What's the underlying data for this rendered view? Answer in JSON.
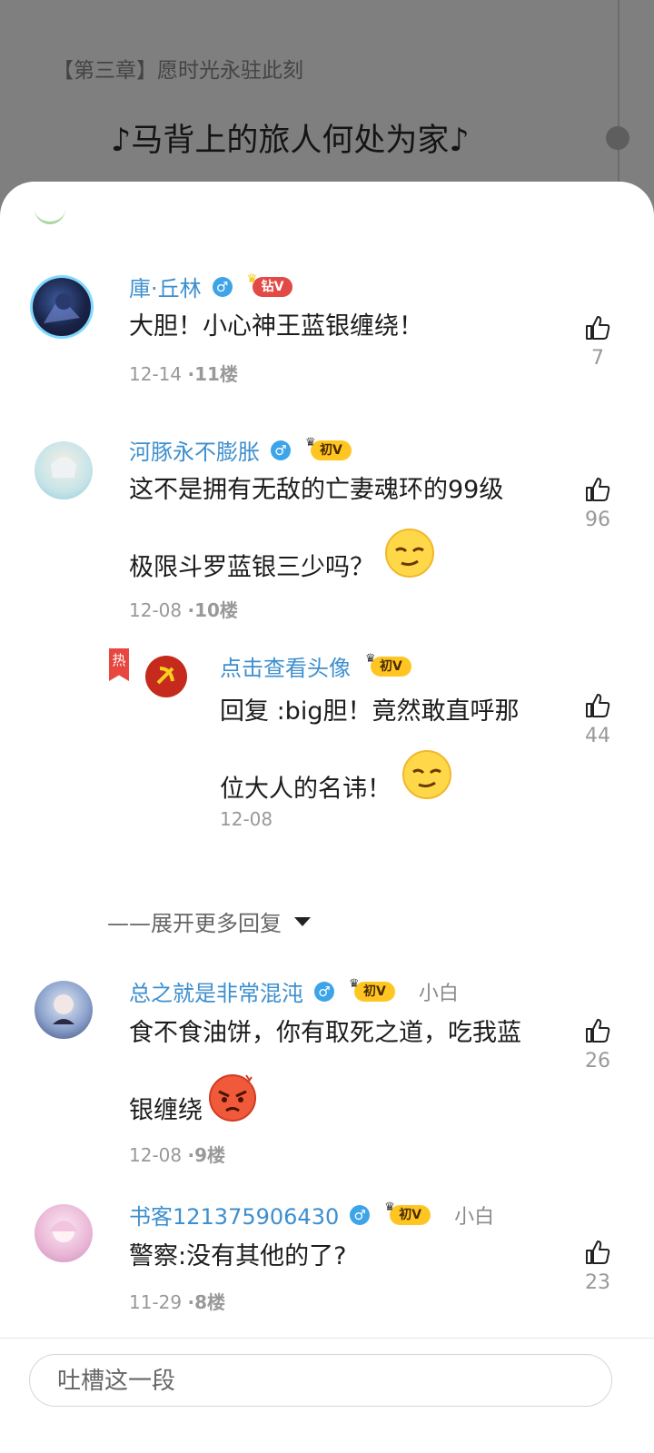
{
  "background": {
    "chapter_title": "【第三章】愿时光永驻此刻",
    "song_title": "♪马背上的旅人何处为家♪"
  },
  "comments": [
    {
      "username": "庫·丘林",
      "gender_icon": "♂",
      "badge": "钻V",
      "text": "大胆！小心神王蓝银缠绕！",
      "date": "12-14",
      "floor": "·11楼",
      "likes": "7"
    },
    {
      "username": "河豚永不膨胀",
      "gender_icon": "♂",
      "badge": "初V",
      "text_line1": "这不是拥有无敌的亡妻魂环的99级",
      "text_line2": "极限斗罗蓝银三少吗？",
      "date": "12-08",
      "floor": "·10楼",
      "likes": "96"
    },
    {
      "username": "总之就是非常混沌",
      "gender_icon": "♂",
      "badge": "初V",
      "title_tag": "小白",
      "text_line1": "食不食油饼，你有取死之道，吃我蓝",
      "text_line2": "银缠绕",
      "date": "12-08",
      "floor": "·9楼",
      "likes": "26"
    },
    {
      "username": "书客121375906430",
      "gender_icon": "♂",
      "badge": "初V",
      "title_tag": "小白",
      "text": "警察:没有其他的了?",
      "date": "11-29",
      "floor": "·8楼",
      "likes": "23"
    }
  ],
  "reply": {
    "hot_label": "热",
    "username": "点击查看头像",
    "badge": "初V",
    "text_line1": "回复 :big胆！竟然敢直呼那",
    "text_line2": "位大人的名讳！",
    "date": "12-08",
    "likes": "44"
  },
  "expand_more": "——展开更多回复",
  "comment_input": {
    "placeholder": "吐槽这一段"
  },
  "colors": {
    "username": "#3d8fcf",
    "badge_gold": "#ffc623",
    "badge_diamond": "#e24a46",
    "hot_tag": "#e7473f",
    "overlay_dim": "#7f7f7f"
  },
  "icons": [
    "thumbs-up-icon",
    "male-icon",
    "crown-icon",
    "caret-down-icon",
    "smug-emoji-icon",
    "angry-emoji-icon"
  ]
}
